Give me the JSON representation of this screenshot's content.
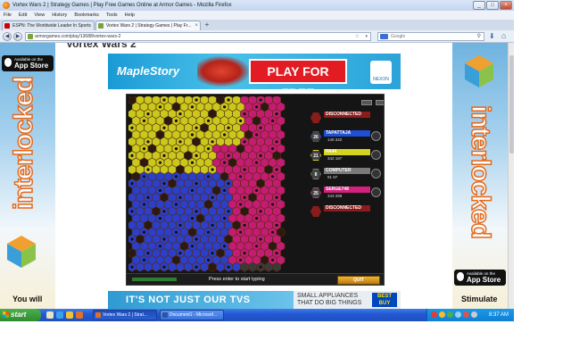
{
  "window": {
    "title": "Vortex Wars 2 | Strategy Games | Play Free Games Online at Armor Games - Mozilla Firefox"
  },
  "menu": [
    "File",
    "Edit",
    "View",
    "History",
    "Bookmarks",
    "Tools",
    "Help"
  ],
  "tabs": [
    {
      "label": "ESPN: The Worldwide Leader In Sports",
      "active": false
    },
    {
      "label": "Vortex Wars 2 | Strategy Games | Play Fr...",
      "active": true
    }
  ],
  "urlbar": {
    "url": "armorgames.com/play/13688/vortex-wars-2"
  },
  "searchbar": {
    "placeholder": "Google"
  },
  "page": {
    "game_title": "Vortex Wars 2",
    "top_banner": {
      "brand": "MapleStory",
      "cta": "PLAY FOR FREE",
      "publisher": "NEXON"
    },
    "left_ad": {
      "store_small": "Available on the",
      "store_big": "App Store",
      "brand": "interlocked",
      "caption": "You will"
    },
    "right_ad": {
      "store_small": "Available on the",
      "store_big": "App Store",
      "brand": "interlocked",
      "caption": "Stimulate"
    },
    "bottom_banner": {
      "left_text": "IT'S NOT JUST OUR TVS",
      "right_line1": "SMALL APPLIANCES",
      "right_line2": "THAT DO BIG THINGS",
      "logo": "BEST BUY"
    }
  },
  "game": {
    "players": [
      {
        "name": "DISCONNECTED",
        "count": "",
        "color": "#8a1c1c",
        "stats": ""
      },
      {
        "name": "TAPATTAJA",
        "count": "26",
        "color": "#1f4fd6",
        "stats": "140  342"
      },
      {
        "name": "PA44",
        "count": "21",
        "color": "#d4d420",
        "stats": "342  187"
      },
      {
        "name": "COMPUTER",
        "count": "8",
        "color": "#7a7a7a",
        "stats": "91  97"
      },
      {
        "name": "SERGE748",
        "count": "25",
        "color": "#d62080",
        "stats": "343  288"
      },
      {
        "name": "DISCONNECTED",
        "count": "",
        "color": "#8a1c1c",
        "stats": ""
      }
    ],
    "chat_prompt": "Press enter to start typing",
    "quit_label": "QUIT",
    "small_buttons": [
      "",
      "",
      "",
      ""
    ]
  },
  "taskbar": {
    "start_label": "start",
    "tasks": [
      {
        "label": "Vortex Wars 2 | Strat...",
        "active": true
      },
      {
        "label": "Document1 - Microsof...",
        "active": false
      }
    ],
    "clock": "8:37 AM"
  }
}
